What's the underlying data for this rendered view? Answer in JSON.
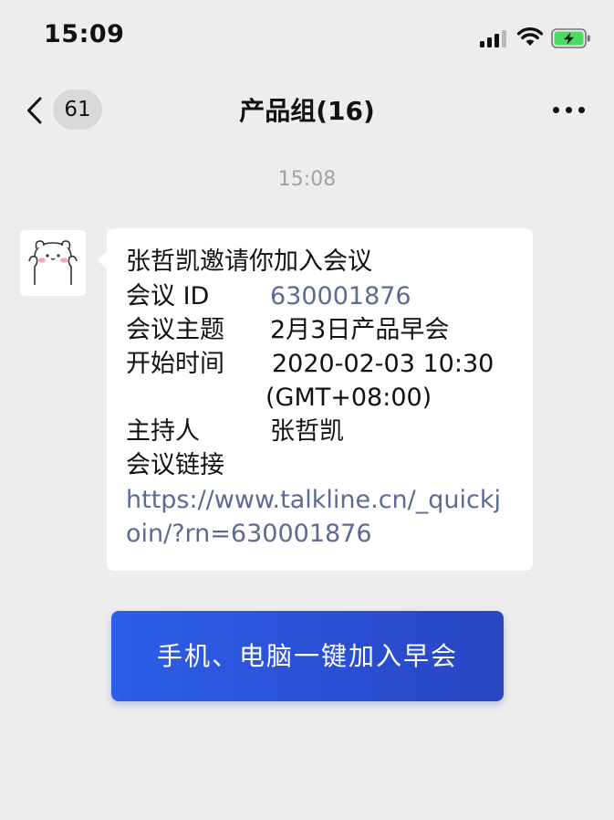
{
  "status_bar": {
    "time": "15:09",
    "signal_icon": "cellular-signal-icon",
    "wifi_icon": "wifi-icon",
    "battery_icon": "battery-charging-icon",
    "battery_color": "#4cd964"
  },
  "nav": {
    "back_icon": "chevron-left-icon",
    "unread_count": "61",
    "title": "产品组(16)",
    "more_icon": "more-dots-icon"
  },
  "chat": {
    "timestamp": "15:08",
    "message": {
      "avatar": "bear-sticker-avatar",
      "lines": {
        "invite": "张哲凯邀请你加入会议",
        "id_label": "会议 ID",
        "id_value": "630001876",
        "topic_label": "会议主题",
        "topic_value": "2月3日产品早会",
        "time_label": "开始时间",
        "time_value": "2020-02-03 10:30",
        "time_zone": "(GMT+08:00)",
        "host_label": "主持人",
        "host_value": "张哲凯",
        "link_label": "会议链接",
        "link_line1": "https://www.talkline.cn/_quickj",
        "link_line2": "oin/?rn=630001876"
      },
      "link_color": "#5b6b92"
    }
  },
  "join_button": {
    "label": "手机、电脑一键加入早会",
    "color": "#2a52d6"
  }
}
